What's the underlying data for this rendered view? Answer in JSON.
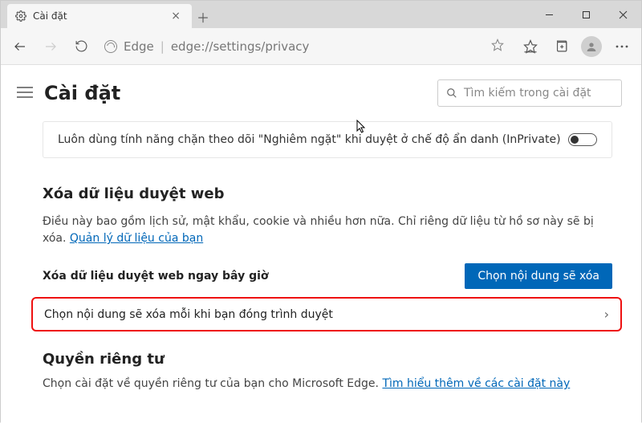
{
  "tab": {
    "title": "Cài đặt"
  },
  "address": {
    "brand": "Edge",
    "url": "edge://settings/privacy"
  },
  "page": {
    "title": "Cài đặt",
    "search_placeholder": "Tìm kiếm trong cài đặt"
  },
  "tracking_strict": {
    "label": "Luôn dùng tính năng chặn theo dõi \"Nghiêm ngặt\" khi duyệt ở chế độ ẩn danh (InPrivate)",
    "enabled": false
  },
  "clear_section": {
    "heading": "Xóa dữ liệu duyệt web",
    "description_pre": "Điều này bao gồm lịch sử, mật khẩu, cookie và nhiều hơn nữa. Chỉ riêng dữ liệu từ hồ sơ này sẽ bị xóa. ",
    "manage_link": "Quản lý dữ liệu của bạn",
    "now_label": "Xóa dữ liệu duyệt web ngay bây giờ",
    "choose_button": "Chọn nội dung sẽ xóa",
    "on_close_label": "Chọn nội dung sẽ xóa mỗi khi bạn đóng trình duyệt"
  },
  "privacy_section": {
    "heading": "Quyền riêng tư",
    "description_pre": "Chọn cài đặt về quyền riêng tư của bạn cho Microsoft Edge. ",
    "learn_link": "Tìm hiểu thêm về các cài đặt này"
  }
}
